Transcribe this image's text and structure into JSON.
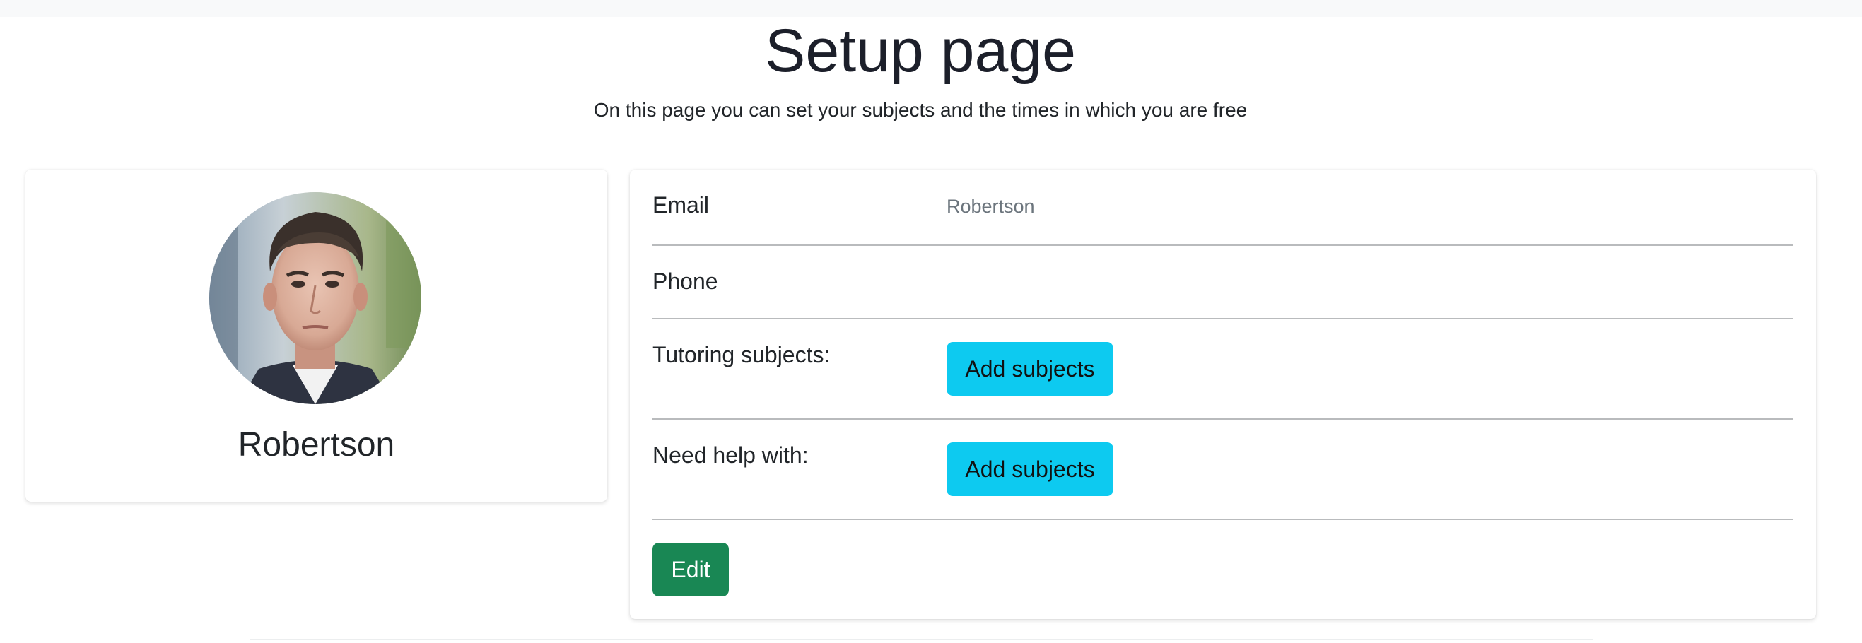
{
  "header": {
    "title": "Setup page",
    "subtitle": "On this page you can set your subjects and the times in which you are free"
  },
  "profile": {
    "name": "Robertson",
    "avatar_alt": "Robertson"
  },
  "details": {
    "email_label": "Email",
    "email_value": "Robertson",
    "phone_label": "Phone",
    "phone_value": "",
    "tutoring_label": "Tutoring subjects:",
    "tutoring_button": "Add subjects",
    "help_label": "Need help with:",
    "help_button": "Add subjects",
    "edit_button": "Edit"
  },
  "colors": {
    "info": "#0dcaf0",
    "success": "#198754",
    "muted": "#6c757d"
  }
}
